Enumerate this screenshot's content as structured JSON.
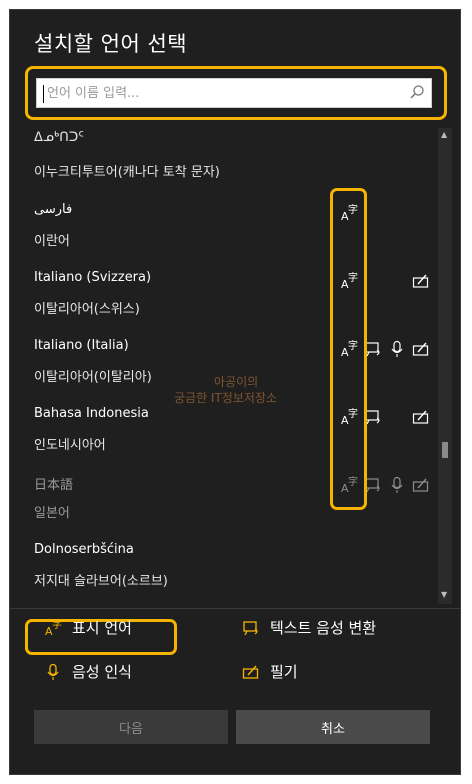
{
  "dialog": {
    "title": "설치할 언어 선택",
    "search_placeholder": "언어 이름 입력..."
  },
  "languages": [
    {
      "native": "ᐃᓄᒃᑎᑐᑦ",
      "korean": "이누크티투트어(캐나다 토착 문자)",
      "partial": true
    },
    {
      "native": "فارسی",
      "korean": "이란어",
      "features": [
        "display-language"
      ]
    },
    {
      "native": "Italiano (Svizzera)",
      "korean": "이탈리아어(스위스)",
      "features": [
        "display-language",
        "handwriting"
      ]
    },
    {
      "native": "Italiano (Italia)",
      "korean": "이탈리아어(이탈리아)",
      "features": [
        "display-language",
        "text-to-speech",
        "speech-recognition",
        "handwriting"
      ]
    },
    {
      "native": "Bahasa Indonesia",
      "korean": "인도네시아어",
      "features": [
        "display-language",
        "text-to-speech",
        "handwriting"
      ]
    },
    {
      "native": "日本語",
      "korean": "일본어",
      "dimmed": true,
      "features": [
        "display-language",
        "text-to-speech",
        "speech-recognition",
        "handwriting"
      ]
    },
    {
      "native": "Dolnoserbšćina",
      "korean": "저지대 슬라브어(소르브)"
    }
  ],
  "legend": {
    "display_language": "표시 언어",
    "text_to_speech": "텍스트 음성 변환",
    "speech_recognition": "음성 인식",
    "handwriting": "필기"
  },
  "buttons": {
    "next": "다음",
    "cancel": "취소"
  },
  "watermark": {
    "line1": "아공이의",
    "line2": "궁금한 IT정보저장소"
  },
  "colors": {
    "highlight": "#f5b400",
    "background": "#1f1f1f"
  }
}
